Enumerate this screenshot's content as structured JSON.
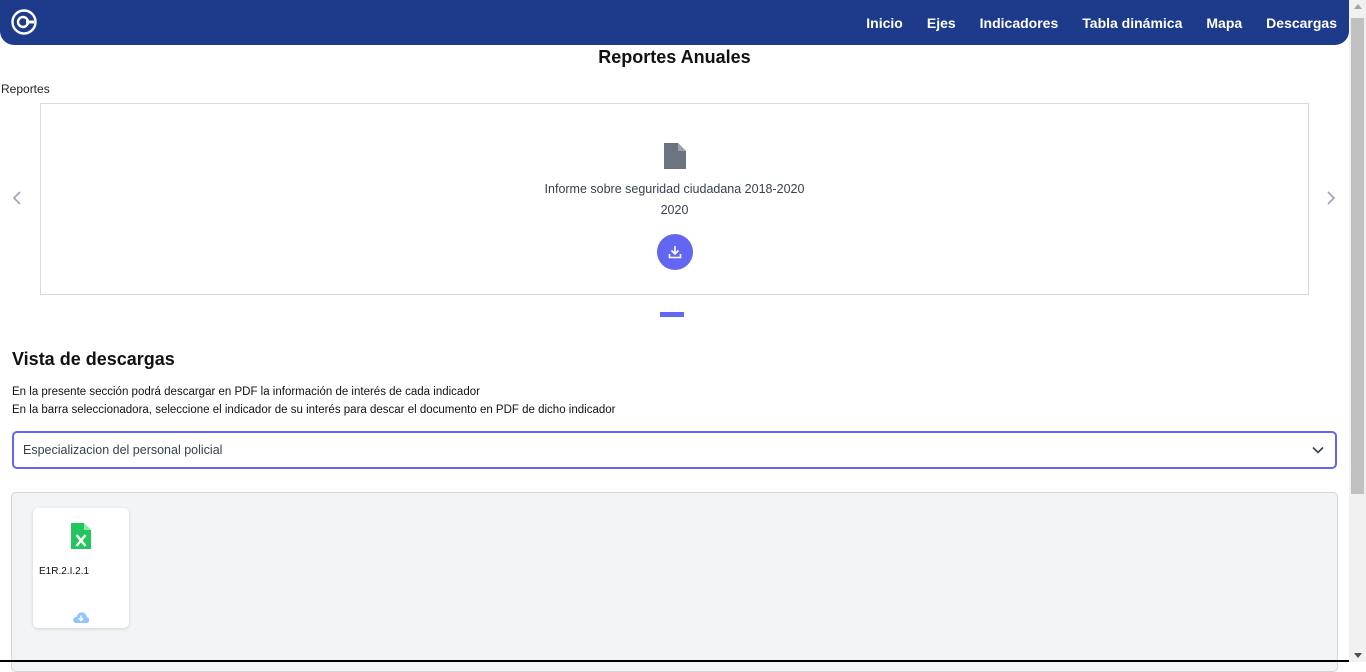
{
  "nav": {
    "items": [
      {
        "label": "Inicio"
      },
      {
        "label": "Ejes"
      },
      {
        "label": "Indicadores"
      },
      {
        "label": "Tabla dinámica"
      },
      {
        "label": "Mapa"
      },
      {
        "label": "Descargas"
      }
    ]
  },
  "page": {
    "title": "Reportes Anuales",
    "section_label": "Reportes"
  },
  "carousel": {
    "report_title": "Informe sobre seguridad ciudadana 2018-2020",
    "report_year": "2020",
    "icon": "document-icon"
  },
  "downloads": {
    "title": "Vista de descargas",
    "description_1": "En la presente sección podrá descargar en PDF la información de interés de cada indicador",
    "description_2": "En la barra seleccionadora, seleccione el indicador de su interés para descar el documento en PDF de dicho indicador",
    "select_value": "Especializacion del personal policial",
    "files": [
      {
        "name": "E1R.2.I.2.1",
        "icon": "excel-file-icon"
      }
    ]
  },
  "colors": {
    "nav_bg": "#1e3a8a",
    "accent": "#6366f1",
    "excel_green": "#22c55e"
  }
}
